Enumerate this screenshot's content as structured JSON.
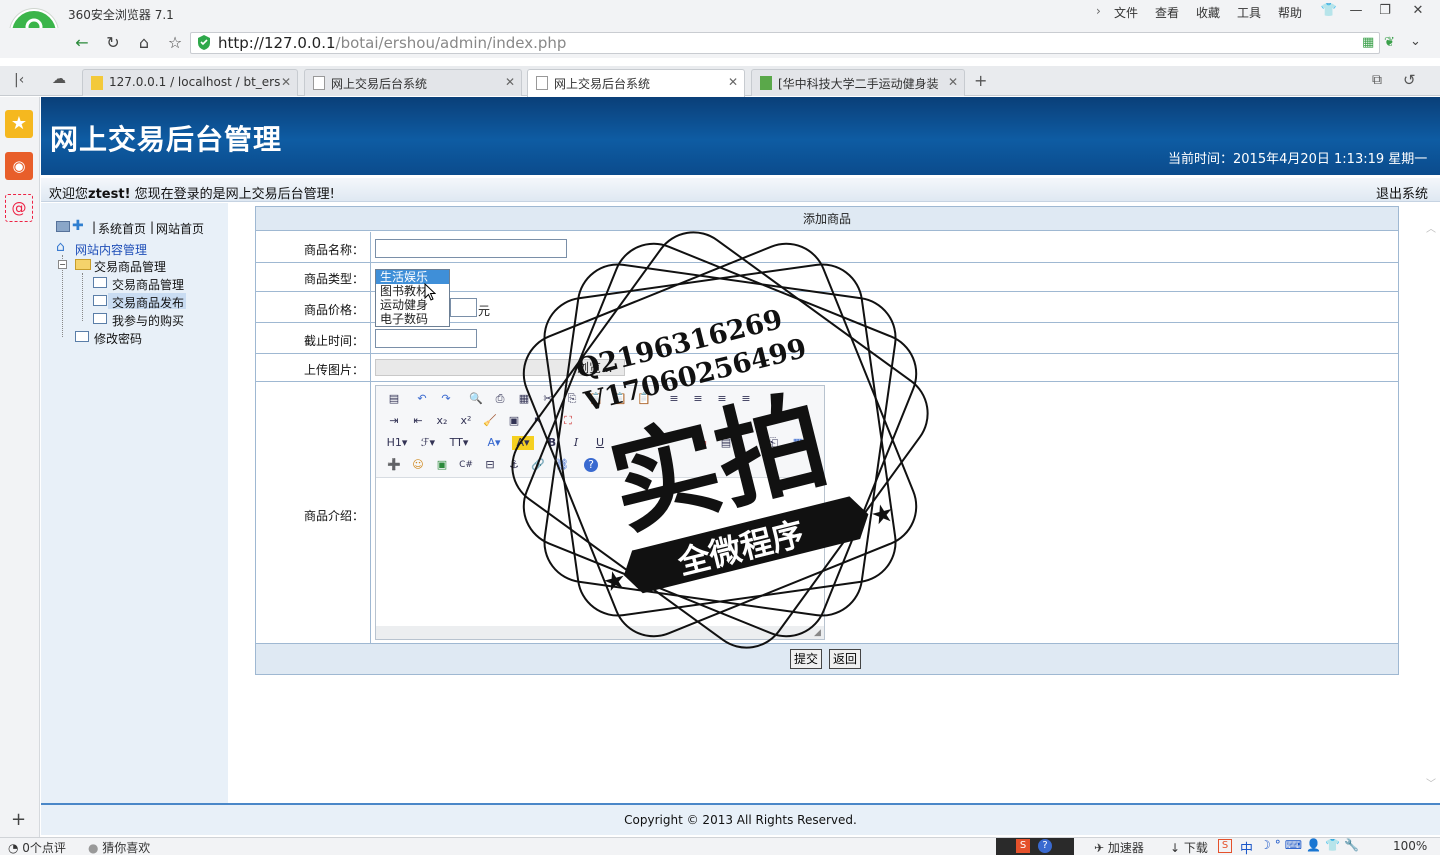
{
  "browser": {
    "title": "360安全浏览器 7.1",
    "menu": [
      "文件",
      "查看",
      "收藏",
      "工具",
      "帮助"
    ],
    "url_host": "http://127.0.0.1",
    "url_path": "/botai/ershou/admin/index.php",
    "tabs": [
      {
        "label": "127.0.0.1 / localhost / bt_ers"
      },
      {
        "label": "网上交易后台系统"
      },
      {
        "label": "网上交易后台系统"
      },
      {
        "label": "[华中科技大学二手运动健身装"
      }
    ],
    "status_left": "0个点评",
    "status_guess": "猜你喜欢",
    "status_accel": "加速器",
    "status_download": "下载",
    "status_ime": "中",
    "zoom": "100%"
  },
  "header": {
    "title": "网上交易后台管理",
    "time_label": "当前时间：2015年4月20日 1:13:19 星期一",
    "welcome_prefix": "欢迎您",
    "username": "ztest!",
    "welcome_suffix": " 您现在登录的是网上交易后台管理!",
    "logout": "退出系统"
  },
  "nav": {
    "home": "系统首页",
    "site_home": "网站首页",
    "sep": "|",
    "root": "网站内容管理",
    "group": "交易商品管理",
    "items": [
      "交易商品管理",
      "交易商品发布",
      "我参与的购买"
    ],
    "password": "修改密码"
  },
  "form": {
    "title": "添加商品",
    "name_label": "商品名称：",
    "type_label": "商品类型：",
    "type_options": [
      "生活娱乐",
      "图书教材",
      "运动健身",
      "电子数码"
    ],
    "price_label": "商品价格：",
    "price_unit": "元",
    "deadline_label": "截止时间：",
    "image_label": "上传图片：",
    "browse": "浏览...",
    "intro_label": "商品介绍：",
    "submit": "提交",
    "back": "返回"
  },
  "footer": {
    "copyright": "Copyright © 2013 All Rights Reserved."
  },
  "watermark": {
    "line1": "Q2196316269",
    "line2": "V17060256499",
    "main": "实拍",
    "ribbon": "全微程序"
  }
}
